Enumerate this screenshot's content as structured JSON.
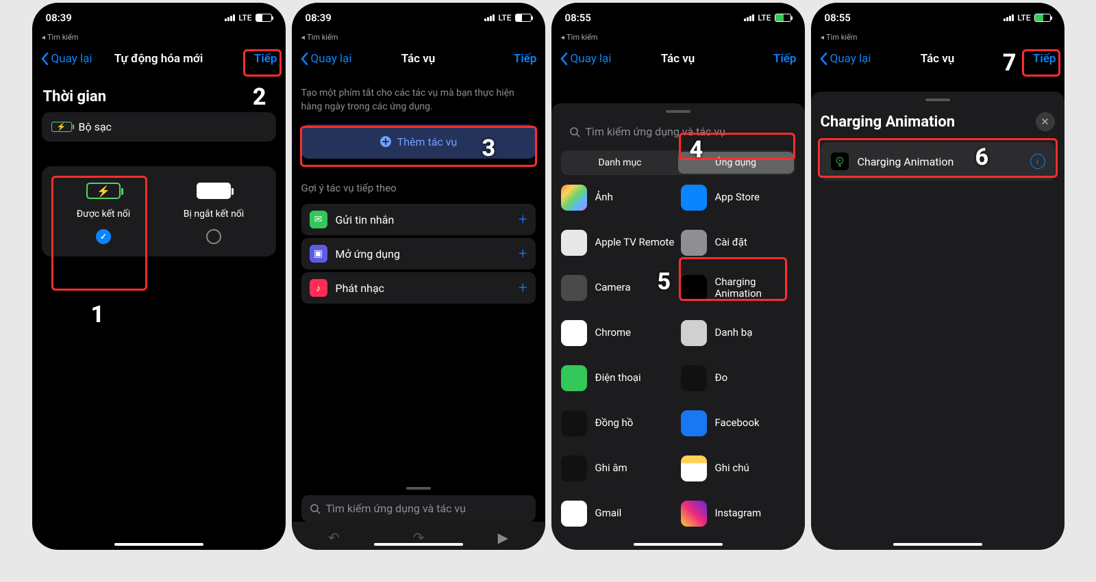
{
  "status": {
    "time1": "08:39",
    "time2": "08:55",
    "crumb": "Tìm kiếm",
    "net": "LTE"
  },
  "nav": {
    "back": "Quay lại",
    "next": "Tiếp",
    "title1": "Tự động hóa mới",
    "title2": "Tác vụ"
  },
  "screen1": {
    "section": "Thời gian",
    "charger": "Bộ sạc",
    "opt_connected": "Được kết nối",
    "opt_disconnected": "Bị ngắt kết nối"
  },
  "screen2": {
    "hint": "Tạo một phím tắt cho các tác vụ mà bạn thực hiện hàng ngày trong các ứng dụng.",
    "add_action": "Thêm tác vụ",
    "sugg_title": "Gợi ý tác vụ tiếp theo",
    "sugg": [
      {
        "label": "Gửi tin nhắn",
        "color": "#34c759",
        "glyph": "✉"
      },
      {
        "label": "Mở ứng dụng",
        "color": "#5e5ce6",
        "glyph": "▣"
      },
      {
        "label": "Phát nhạc",
        "color": "#ff2d55",
        "glyph": "♪"
      }
    ],
    "search_ph": "Tìm kiếm ứng dụng và tác vụ"
  },
  "screen3": {
    "search_ph": "Tìm kiếm ứng dụng và tác vụ",
    "seg_cat": "Danh mục",
    "seg_app": "Ứng dụng",
    "apps_left": [
      {
        "label": "Ảnh",
        "bg": "linear-gradient(135deg,#ff7a59,#ffd257,#6ed36e,#59b6ff,#c77dff)"
      },
      {
        "label": "Apple TV Remote",
        "bg": "#e8e8e8"
      },
      {
        "label": "Camera",
        "bg": "#4a4a4a"
      },
      {
        "label": "Chrome",
        "bg": "#fff"
      },
      {
        "label": "Điện thoại",
        "bg": "#34c759"
      },
      {
        "label": "Đồng hồ",
        "bg": "#111"
      },
      {
        "label": "Ghi âm",
        "bg": "#111"
      },
      {
        "label": "Gmail",
        "bg": "#fff"
      }
    ],
    "apps_right": [
      {
        "label": "App Store",
        "bg": "#0a84ff"
      },
      {
        "label": "Cài đặt",
        "bg": "#8e8e93"
      },
      {
        "label": "Charging Animation",
        "bg": "#000"
      },
      {
        "label": "Danh bạ",
        "bg": "#d0d0d0"
      },
      {
        "label": "Đo",
        "bg": "#111"
      },
      {
        "label": "Facebook",
        "bg": "#1877f2"
      },
      {
        "label": "Ghi chú",
        "bg": "linear-gradient(#ffd257 30%,#fff 30%)"
      },
      {
        "label": "Instagram",
        "bg": "linear-gradient(45deg,#f9ce34,#ee2a7b,#6228d7)"
      }
    ]
  },
  "screen4": {
    "sheet_title": "Charging Animation",
    "item_label": "Charging Animation"
  },
  "steps": {
    "s1": "1",
    "s2": "2",
    "s3": "3",
    "s4": "4",
    "s5": "5",
    "s6": "6",
    "s7": "7"
  }
}
